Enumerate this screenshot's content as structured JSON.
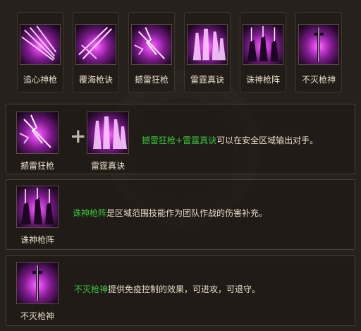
{
  "skills": [
    {
      "name": "追心神枪",
      "icon": "spear-burst-icon"
    },
    {
      "name": "覆海枪诀",
      "icon": "spear-slash-icon"
    },
    {
      "name": "撼雷狂枪",
      "icon": "thunder-spear-icon"
    },
    {
      "name": "雷霆真诀",
      "icon": "thunder-spikes-icon"
    },
    {
      "name": "诛神枪阵",
      "icon": "spear-formation-icon"
    },
    {
      "name": "不灭枪神",
      "icon": "immortal-spear-icon"
    }
  ],
  "combo1": {
    "left_label": "撼雷狂枪",
    "right_label": "雷霆真诀",
    "plus": "+",
    "hl_a": "撼雷狂枪",
    "joiner": "+",
    "hl_b": "雷霆真诀",
    "text": "可以在安全区域输出对手。"
  },
  "combo2": {
    "label": "诛神枪阵",
    "hl": "诛神枪阵",
    "text": "是区域范围技能作为团队作战的伤害补充。"
  },
  "combo3": {
    "label": "不灭枪神",
    "hl": "不灭枪神",
    "text": "提供免疫控制的效果，可进攻，可退守。"
  },
  "colors": {
    "highlight": "#39c73a",
    "text": "#e8dcc6",
    "glow": "#d43fe0"
  }
}
